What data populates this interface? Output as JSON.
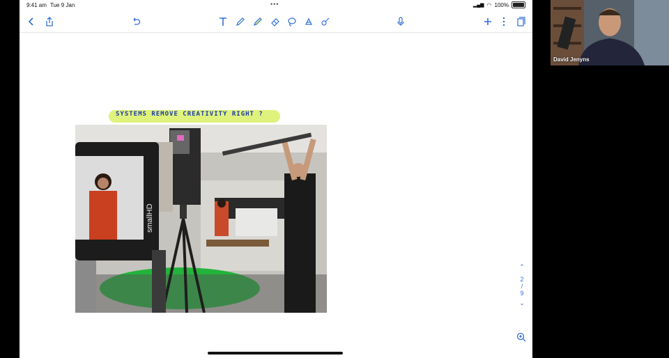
{
  "status_bar": {
    "time": "9:41 am",
    "date": "Tue 9 Jan",
    "dots": "•••",
    "battery": "100%"
  },
  "toolbar": {
    "icons": [
      "back-icon",
      "share-icon",
      "undo-icon",
      "text-tool-icon",
      "pen-tool-icon",
      "highlighter-tool-icon",
      "eraser-tool-icon",
      "lasso-tool-icon",
      "image-tool-icon",
      "shape-tool-icon",
      "mic-icon",
      "add-icon",
      "more-icon",
      "pages-icon"
    ]
  },
  "note": {
    "handwritten_text": "SYSTEMS REMOVE CREATIVITY RIGHT ?",
    "highlight_color": "#dff27c",
    "ink_color": "#1c3aa8",
    "monitor_brand": "smallHD"
  },
  "page_nav": {
    "current": "2",
    "separator": "/",
    "total": "9"
  },
  "participant": {
    "name": "David Jenyns"
  },
  "colors": {
    "accent": "#2f6fd6"
  }
}
